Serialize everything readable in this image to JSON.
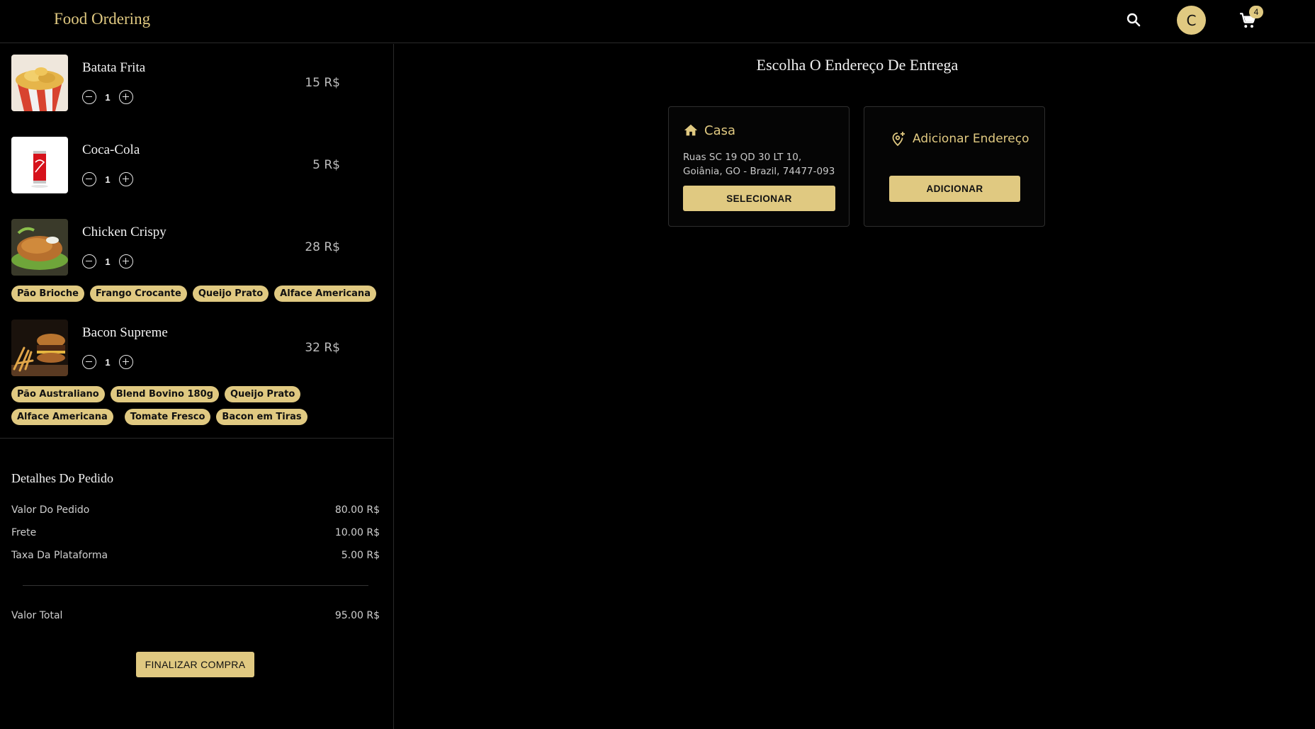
{
  "header": {
    "brand": "Food Ordering",
    "avatar_initial": "C",
    "cart_count": "4",
    "icons": [
      "search-icon",
      "cart-icon"
    ]
  },
  "cart": {
    "items": [
      {
        "name": "Batata Frita",
        "qty": "1",
        "price": "15 R$",
        "tags": []
      },
      {
        "name": "Coca-Cola",
        "qty": "1",
        "price": "5 R$",
        "tags": []
      },
      {
        "name": "Chicken Crispy",
        "qty": "1",
        "price": "28 R$",
        "tags": [
          "Pão Brioche",
          "Frango Crocante",
          "Queijo Prato",
          "Alface Americana"
        ]
      },
      {
        "name": "Bacon Supreme",
        "qty": "1",
        "price": "32 R$",
        "tags": [
          "Pão Australiano",
          "Blend Bovino 180g",
          "Queijo Prato",
          "Alface Americana",
          "Tomate Fresco",
          "Bacon em Tiras"
        ]
      }
    ]
  },
  "details": {
    "title": "Detalhes Do Pedido",
    "rows": [
      {
        "label": "Valor Do Pedido",
        "value": "80.00 R$"
      },
      {
        "label": "Frete",
        "value": "10.00 R$"
      },
      {
        "label": "Taxa Da Plataforma",
        "value": "5.00 R$"
      }
    ],
    "total_label": "Valor Total",
    "total_value": "95.00 R$",
    "finalize_label": "FINALIZAR COMPRA"
  },
  "address": {
    "title": "Escolha O Endereço De Entrega",
    "saved": {
      "name": "Casa",
      "line1": "Ruas SC 19 QD 30 LT 10,",
      "line2": "Goiânia, GO - Brazil, 74477-093",
      "button": "SELECIONAR"
    },
    "add": {
      "label": "Adicionar Endereço",
      "button": "ADICIONAR"
    }
  },
  "colors": {
    "accent": "#e0c981",
    "background": "#000000"
  }
}
